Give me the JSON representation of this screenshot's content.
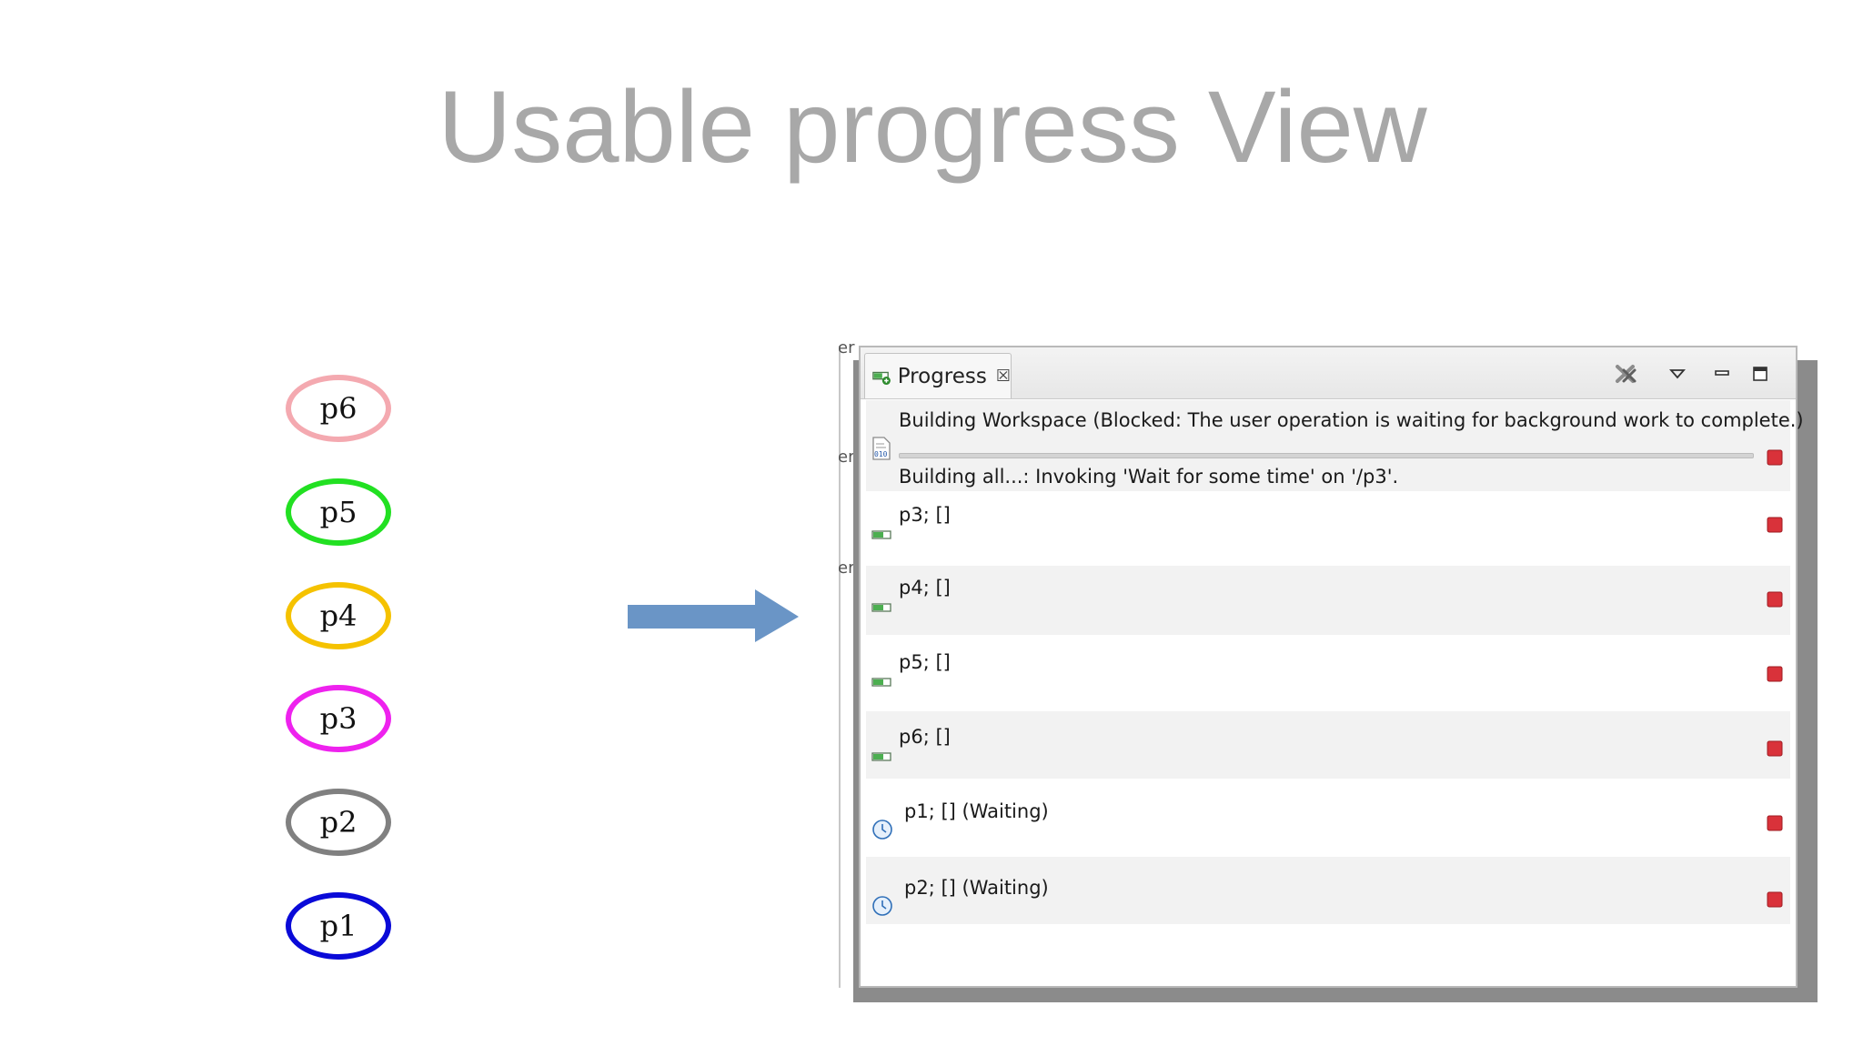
{
  "slide": {
    "title": "Usable progress View"
  },
  "nodes": [
    {
      "label": "p6",
      "color": "#f4a9b0"
    },
    {
      "label": "p5",
      "color": "#22e022"
    },
    {
      "label": "p4",
      "color": "#f5c200"
    },
    {
      "label": "p3",
      "color": "#ee22ee"
    },
    {
      "label": "p2",
      "color": "#808080"
    },
    {
      "label": "p1",
      "color": "#0a0ad8"
    }
  ],
  "arrow": {
    "color": "#6a95c6"
  },
  "background_window": {
    "edge_fragments": [
      "er",
      "er",
      "er"
    ]
  },
  "progress_view": {
    "tab": {
      "label": "Progress",
      "icon": "progress-view-icon",
      "close_glyph": "☒"
    },
    "toolbar": [
      "remove-all-finished-icon",
      "view-menu-icon",
      "minimize-icon",
      "maximize-icon"
    ],
    "main_job": {
      "icon": "binary-build-icon",
      "title": "Building Workspace (Blocked: The user operation is waiting for background work to complete.)",
      "subtask": "Building all...: Invoking 'Wait for some time' on '/p3'."
    },
    "jobs": [
      {
        "label": "p3; []",
        "icon": "progress-job-icon"
      },
      {
        "label": "p4; []",
        "icon": "progress-job-icon"
      },
      {
        "label": "p5; []",
        "icon": "progress-job-icon"
      },
      {
        "label": "p6; []",
        "icon": "progress-job-icon"
      },
      {
        "label": "p1; [] (Waiting)",
        "icon": "clock-icon"
      },
      {
        "label": "p2; [] (Waiting)",
        "icon": "clock-icon"
      }
    ],
    "colors": {
      "stop": "#d9323a",
      "alt_row": "#f2f2f2"
    }
  }
}
